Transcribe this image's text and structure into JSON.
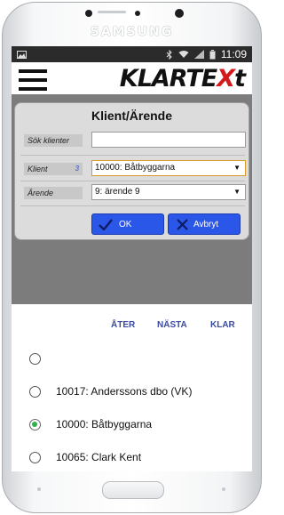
{
  "device": {
    "brand": "SAMSUNG"
  },
  "statusbar": {
    "time": "11:09",
    "icons": [
      "image-icon",
      "bluetooth-icon",
      "wifi-icon",
      "signal-icon",
      "battery-icon"
    ]
  },
  "appbar": {
    "logo_main": "KLARTE",
    "logo_x": "X",
    "logo_end": "t",
    "logo_color": "#d4191b"
  },
  "dialog": {
    "title": "Klient/Ärende",
    "search": {
      "label": "Sök klienter",
      "value": ""
    },
    "client": {
      "label": "Klient",
      "count": "3",
      "selected": "10000: Båtbyggarna"
    },
    "case": {
      "label": "Ärende",
      "selected": "9: ärende 9"
    },
    "ok_label": "OK",
    "cancel_label": "Avbryt"
  },
  "nav": {
    "back": "ÅTER",
    "next": "NÄSTA",
    "done": "KLAR"
  },
  "list": [
    {
      "text": "",
      "selected": false
    },
    {
      "text": "10017: Anderssons dbo (VK)",
      "selected": false
    },
    {
      "text": "10000: Båtbyggarna",
      "selected": true
    },
    {
      "text": "10065: Clark Kent",
      "selected": false
    }
  ]
}
